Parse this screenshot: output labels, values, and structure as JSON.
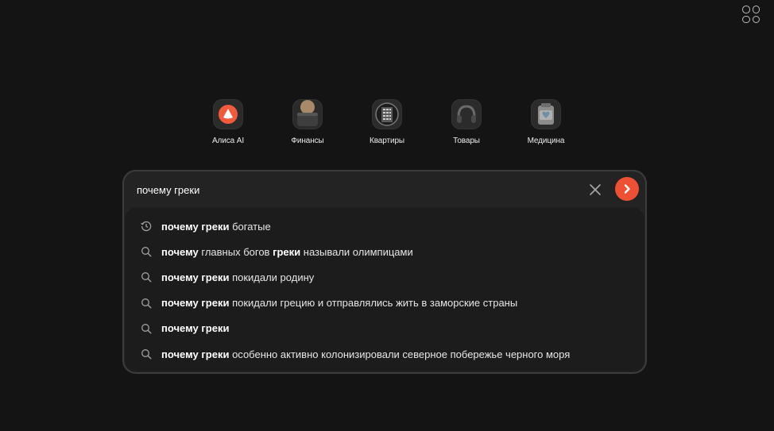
{
  "services": [
    {
      "label": "Алиса AI",
      "icon": "alice-icon"
    },
    {
      "label": "Финансы",
      "icon": "wallet-icon"
    },
    {
      "label": "Квартиры",
      "icon": "building-icon"
    },
    {
      "label": "Товары",
      "icon": "headphones-icon"
    },
    {
      "label": "Медицина",
      "icon": "medkit-icon"
    }
  ],
  "search": {
    "query": "почему греки",
    "accent_color": "#ee5034"
  },
  "suggestions": [
    {
      "icon": "history-icon",
      "parts": [
        [
          "почему греки",
          true
        ],
        [
          " богатые",
          false
        ]
      ]
    },
    {
      "icon": "search-icon",
      "parts": [
        [
          "почему",
          true
        ],
        [
          " главных богов ",
          false
        ],
        [
          "греки",
          true
        ],
        [
          " называли олимпицами",
          false
        ]
      ]
    },
    {
      "icon": "search-icon",
      "parts": [
        [
          "почему греки",
          true
        ],
        [
          " покидали родину",
          false
        ]
      ]
    },
    {
      "icon": "search-icon",
      "parts": [
        [
          "почему греки",
          true
        ],
        [
          " покидали грецию и отправлялись жить в заморские страны",
          false
        ]
      ]
    },
    {
      "icon": "search-icon",
      "parts": [
        [
          "почему греки",
          true
        ]
      ]
    },
    {
      "icon": "search-icon",
      "parts": [
        [
          "почему греки",
          true
        ],
        [
          " особенно активно колонизировали северное побережье черного моря",
          false
        ]
      ]
    }
  ]
}
